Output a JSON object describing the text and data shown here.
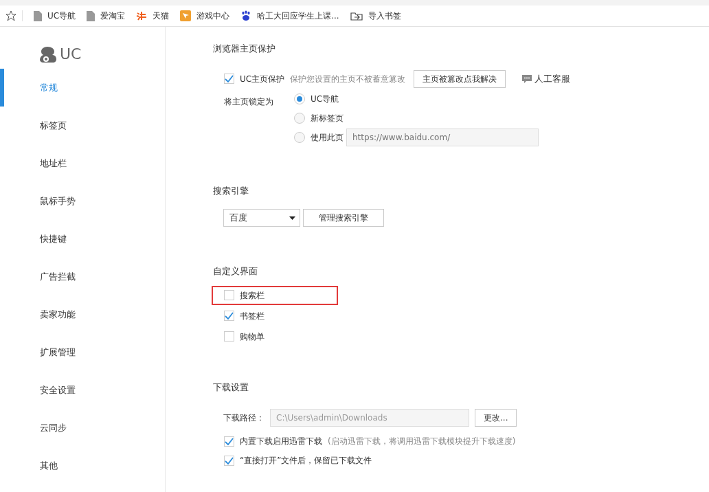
{
  "bookmarks": [
    {
      "kind": "page",
      "label": "UC导航"
    },
    {
      "kind": "page",
      "label": "爱淘宝"
    },
    {
      "kind": "tmall",
      "label": "天猫"
    },
    {
      "kind": "game",
      "label": "游戏中心"
    },
    {
      "kind": "paw",
      "label": "哈工大回应学生上课..."
    },
    {
      "kind": "import",
      "label": "导入书签"
    }
  ],
  "logo": {
    "text": "UC"
  },
  "sidebar": {
    "items": [
      {
        "label": "常规",
        "selected": true
      },
      {
        "label": "标签页",
        "selected": false
      },
      {
        "label": "地址栏",
        "selected": false
      },
      {
        "label": "鼠标手势",
        "selected": false
      },
      {
        "label": "快捷键",
        "selected": false
      },
      {
        "label": "广告拦截",
        "selected": false
      },
      {
        "label": "卖家功能",
        "selected": false
      },
      {
        "label": "扩展管理",
        "selected": false
      },
      {
        "label": "安全设置",
        "selected": false
      },
      {
        "label": "云同步",
        "selected": false
      },
      {
        "label": "其他",
        "selected": false
      }
    ]
  },
  "homepage": {
    "title": "浏览器主页保护",
    "protect": {
      "label": "UC主页保护",
      "checked": true,
      "hint": "保护您设置的主页不被蓄意篡改",
      "button": "主页被篡改点我解决",
      "service": "人工客服"
    },
    "lock_label": "将主页锁定为",
    "options": [
      {
        "label": "UC导航",
        "selected": true
      },
      {
        "label": "新标签页",
        "selected": false
      },
      {
        "label": "使用此页",
        "selected": false,
        "placeholder": "https://www.baidu.com/"
      }
    ]
  },
  "search_engine": {
    "title": "搜索引擎",
    "value": "百度",
    "button": "管理搜索引擎"
  },
  "custom_ui": {
    "title": "自定义界面",
    "items": [
      {
        "label": "搜索栏",
        "checked": false,
        "highlighted": true
      },
      {
        "label": "书签栏",
        "checked": true,
        "highlighted": false
      },
      {
        "label": "购物单",
        "checked": false,
        "highlighted": false
      }
    ]
  },
  "download": {
    "title": "下载设置",
    "path_label": "下载路径：",
    "path": "C:\\Users\\admin\\Downloads",
    "change": "更改...",
    "options": [
      {
        "label": "内置下载启用迅雷下载",
        "note": "(启动迅雷下载，将调用迅雷下载模块提升下载速度)",
        "checked": true
      },
      {
        "label": "“直接打开”文件后，保留已下载文件",
        "checked": true
      }
    ]
  }
}
